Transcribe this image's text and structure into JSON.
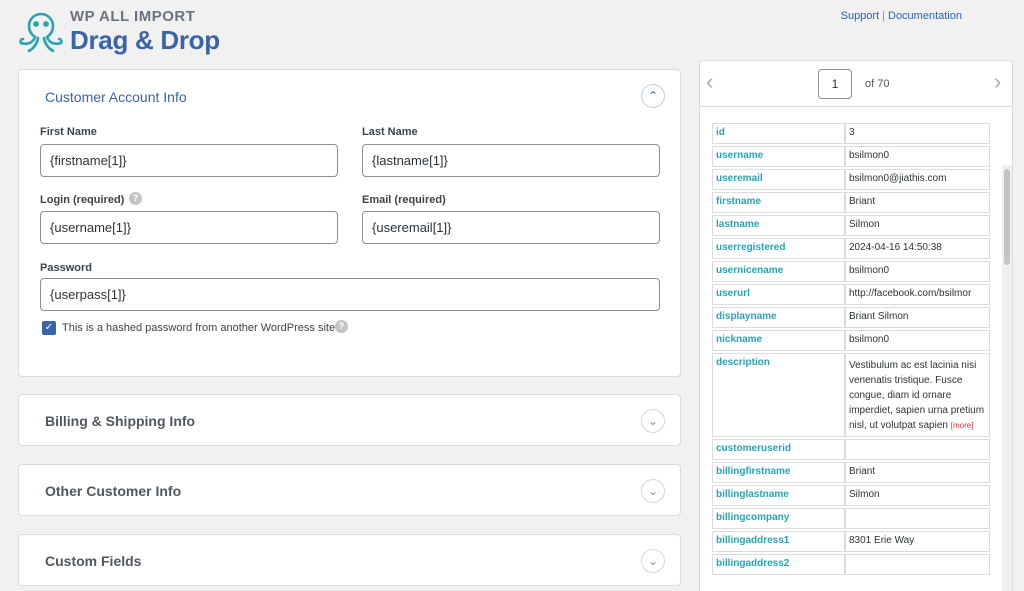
{
  "brand": {
    "top": "WP ALL IMPORT",
    "main": "Drag & Drop"
  },
  "links": {
    "support": "Support",
    "separator": "|",
    "documentation": "Documentation"
  },
  "colors": {
    "accent": "#3a64a8",
    "teal": "#28a4b4",
    "more": "#d63638"
  },
  "account": {
    "title": "Customer Account Info",
    "chevron": "chevron-up-icon",
    "first_name_label": "First Name",
    "first_name_value": "{firstname[1]}",
    "last_name_label": "Last Name",
    "last_name_value": "{lastname[1]}",
    "login_label": "Login (required)",
    "login_value": "{username[1]}",
    "email_label": "Email (required)",
    "email_value": "{useremail[1]}",
    "password_label": "Password",
    "password_value": "{userpass[1]}",
    "hashed_label": "This is a hashed password from another WordPress site",
    "hashed_checked": true
  },
  "sections": {
    "billing": "Billing & Shipping Info",
    "other": "Other Customer Info",
    "custom": "Custom Fields"
  },
  "pager": {
    "current": "1",
    "total": "of 70"
  },
  "record": {
    "more": "[more]",
    "rows": [
      {
        "k": "id",
        "v": "3"
      },
      {
        "k": "username",
        "v": "bsilmon0"
      },
      {
        "k": "useremail",
        "v": "bsilmon0@jiathis.com"
      },
      {
        "k": "firstname",
        "v": "Briant"
      },
      {
        "k": "lastname",
        "v": "Silmon"
      },
      {
        "k": "userregistered",
        "v": "2024-04-16 14:50:38"
      },
      {
        "k": "usernicename",
        "v": "bsilmon0"
      },
      {
        "k": "userurl",
        "v": "http://facebook.com/bsilmor"
      },
      {
        "k": "displayname",
        "v": "Briant Silmon"
      },
      {
        "k": "nickname",
        "v": "bsilmon0"
      },
      {
        "k": "description",
        "v": "Vestibulum ac est lacinia nisi venenatis tristique. Fusce congue, diam id ornare imperdiet, sapien urna pretium nisl, ut volutpat sapien"
      },
      {
        "k": "customeruserid",
        "v": ""
      },
      {
        "k": "billingfirstname",
        "v": "Briant"
      },
      {
        "k": "billinglastname",
        "v": "Silmon"
      },
      {
        "k": "billingcompany",
        "v": ""
      },
      {
        "k": "billingaddress1",
        "v": "8301 Erie Way"
      },
      {
        "k": "billingaddress2",
        "v": ""
      }
    ]
  }
}
